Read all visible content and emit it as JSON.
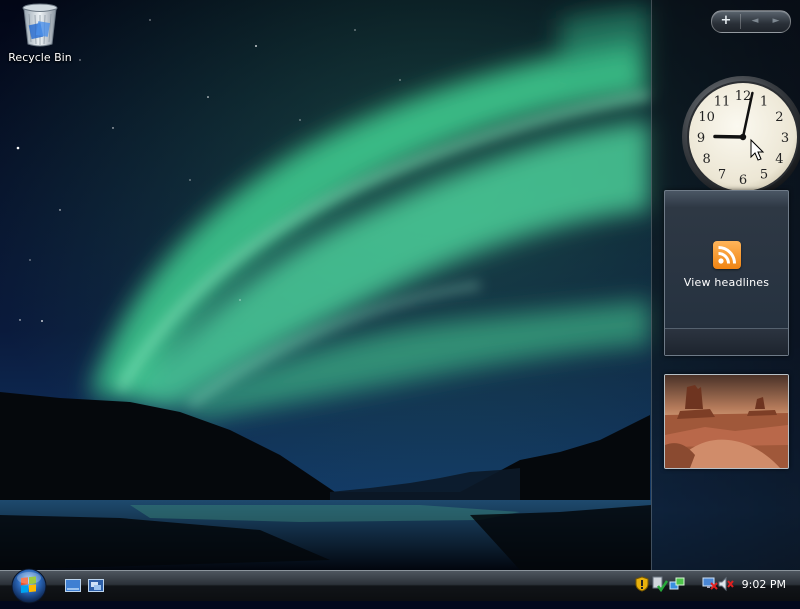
{
  "desktop": {
    "icons": [
      {
        "label": "Recycle Bin",
        "icon": "recycle-bin-icon"
      }
    ]
  },
  "sidebar": {
    "controls": {
      "add": "+",
      "prev": "◄",
      "next": "►"
    },
    "clock_gadget": {
      "numbers": [
        "12",
        "1",
        "2",
        "3",
        "4",
        "5",
        "6",
        "7",
        "8",
        "9",
        "10",
        "11"
      ],
      "hour": 9,
      "minute": 2
    },
    "feed_gadget": {
      "label": "View headlines",
      "icon": "rss-feed-icon"
    },
    "slideshow_gadget": {
      "icon": "slideshow-photo"
    }
  },
  "taskbar": {
    "start_icon": "windows-start-orb",
    "quick_launch": [
      "show-desktop-icon",
      "switch-windows-icon"
    ],
    "tray_icons": [
      "security-alert-icon",
      "windows-update-icon",
      "network-icon",
      "speaker-muted-icon"
    ],
    "clock": "9:02 PM"
  },
  "colors": {
    "aurora": "#4fe0a0",
    "taskbar": "#1a1e23",
    "rss_orange": "#f08412"
  }
}
